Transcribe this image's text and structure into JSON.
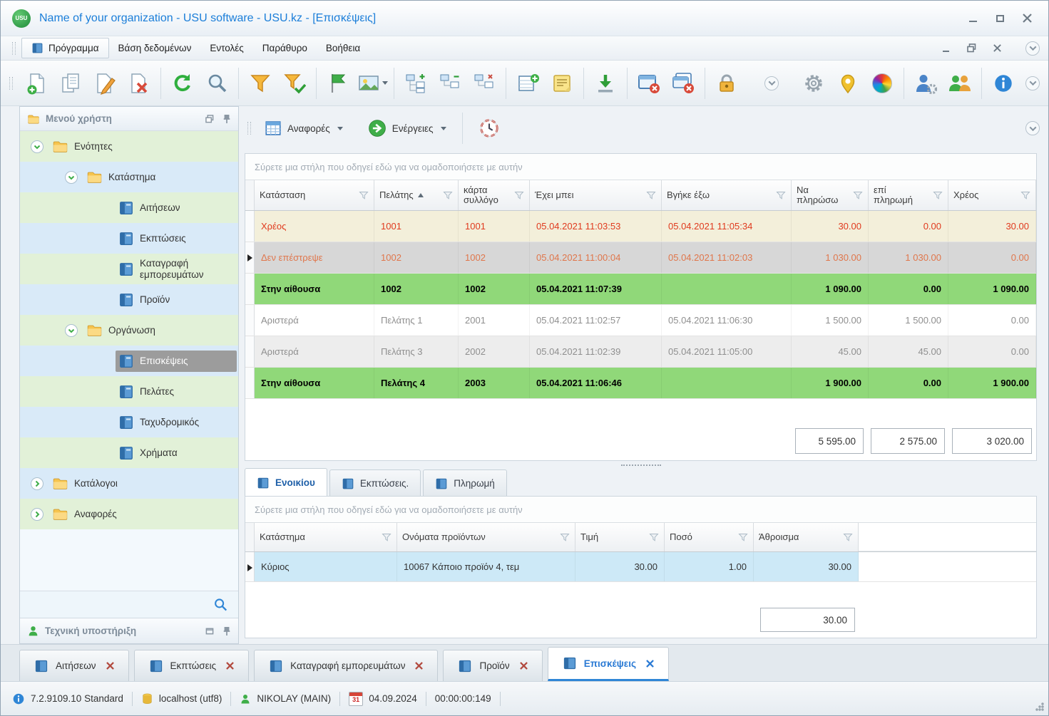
{
  "window": {
    "title": "Name of your organization - USU software - USU.kz - [Επισκέψεις]",
    "logo_text": "USU"
  },
  "menubar": {
    "items": [
      "Πρόγραμμα",
      "Βάση δεδομένων",
      "Εντολές",
      "Παράθυρο",
      "Βοήθεια"
    ]
  },
  "toolbar": {
    "icons": [
      "new-document",
      "copy-document",
      "edit-document",
      "delete-document",
      "refresh",
      "search",
      "filter",
      "filter-ok",
      "flag",
      "image",
      "expand-tree",
      "collapse-tree",
      "collapse-all-tree",
      "add-record",
      "notes",
      "export",
      "close-window",
      "close-all-windows",
      "lock",
      "collapse-chevron",
      "settings",
      "location",
      "palette",
      "user-settings",
      "users",
      "info"
    ]
  },
  "sidebar": {
    "header": "Μενού χρήστη",
    "tree": [
      {
        "label": "Ενότητες"
      },
      {
        "label": "Κατάστημα"
      },
      {
        "label": "Αιτήσεων"
      },
      {
        "label": "Εκπτώσεις"
      },
      {
        "label": "Καταγραφή εμπορευμάτων"
      },
      {
        "label": "Προϊόν"
      },
      {
        "label": "Οργάνωση"
      },
      {
        "label": "Επισκέψεις"
      },
      {
        "label": "Πελάτες"
      },
      {
        "label": "Ταχυδρομικός"
      },
      {
        "label": "Χρήματα"
      },
      {
        "label": "Κατάλογοι"
      },
      {
        "label": "Αναφορές"
      }
    ],
    "support_header": "Τεχνική υποστήριξη"
  },
  "content_toolbar": {
    "reports_label": "Αναφορές",
    "actions_label": "Ενέργειες"
  },
  "grid": {
    "group_hint": "Σύρετε μια στήλη που οδηγεί εδώ για να ομαδοποιήσετε με αυτήν",
    "columns": [
      "Κατάσταση",
      "Πελάτης",
      "κάρτα συλλόγο",
      "Έχει μπει",
      "Βγήκε έξω",
      "Να πληρώσω",
      "επί πληρωμή",
      "Χρέος"
    ],
    "rows": [
      [
        "Χρέος",
        "1001",
        "1001",
        "05.04.2021 11:03:53",
        "05.04.2021 11:05:34",
        "30.00",
        "0.00",
        "30.00"
      ],
      [
        "Δεν επέστρεψε",
        "1002",
        "1002",
        "05.04.2021 11:00:04",
        "05.04.2021 11:02:03",
        "1 030.00",
        "1 030.00",
        "0.00"
      ],
      [
        "Στην αίθουσα",
        "1002",
        "1002",
        "05.04.2021 11:07:39",
        "",
        "1 090.00",
        "0.00",
        "1 090.00"
      ],
      [
        "Αριστερά",
        "Πελάτης 1",
        "2001",
        "05.04.2021 11:02:57",
        "05.04.2021 11:06:30",
        "1 500.00",
        "1 500.00",
        "0.00"
      ],
      [
        "Αριστερά",
        "Πελάτης 3",
        "2002",
        "05.04.2021 11:02:39",
        "05.04.2021 11:05:00",
        "45.00",
        "45.00",
        "0.00"
      ],
      [
        "Στην αίθουσα",
        "Πελάτης 4",
        "2003",
        "05.04.2021 11:06:46",
        "",
        "1 900.00",
        "0.00",
        "1 900.00"
      ]
    ],
    "totals": [
      "5 595.00",
      "2 575.00",
      "3 020.00"
    ]
  },
  "detail": {
    "tabs": [
      "Ενοικίου",
      "Εκπτώσεις.",
      "Πληρωμή"
    ],
    "group_hint": "Σύρετε μια στήλη που οδηγεί εδώ για να ομαδοποιήσετε με αυτήν",
    "columns": [
      "Κατάστημα",
      "Ονόματα προϊόντων",
      "Τιμή",
      "Ποσό",
      "Άθροισμα"
    ],
    "rows": [
      [
        "Κύριος",
        "10067 Κάποιο προϊόν 4, τεμ",
        "30.00",
        "1.00",
        "30.00"
      ]
    ],
    "total": "30.00"
  },
  "doc_tabs": [
    "Αιτήσεων",
    "Εκπτώσεις",
    "Καταγραφή εμπορευμάτων",
    "Προϊόν",
    "Επισκέψεις"
  ],
  "statusbar": {
    "version": "7.2.9109.10 Standard",
    "host": "localhost (utf8)",
    "user": "NIKOLAY (MAIN)",
    "calendar_day": "31",
    "date": "04.09.2024",
    "timer": "00:00:00:149"
  },
  "colors": {
    "accent_blue": "#1b7ed9",
    "row_debt_bg": "#f3efda",
    "row_debt_text": "#e03a1e",
    "row_selected_bg": "#d7d7d7",
    "row_selected_text": "#e0764b",
    "row_inhall_bg": "#90d879",
    "row_left_text": "#8f8f8f",
    "detail_row_bg": "#cde9f7"
  }
}
